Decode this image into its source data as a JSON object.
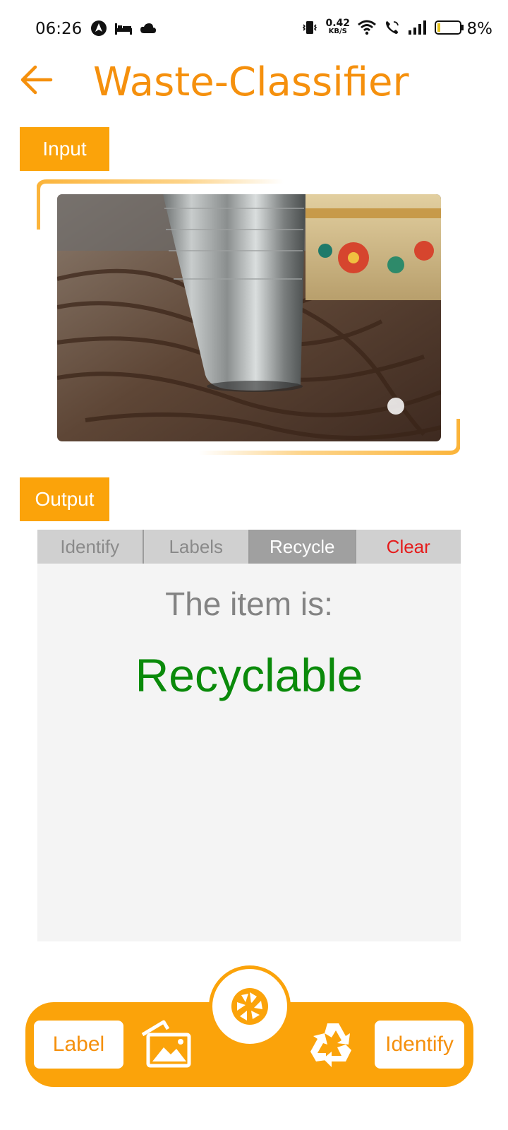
{
  "status_bar": {
    "time": "06:26",
    "net_speed_value": "0.42",
    "net_speed_unit": "KB/S",
    "battery": "8%"
  },
  "app": {
    "title": "Waste-Classifier"
  },
  "input_section": {
    "label": "Input"
  },
  "output_section": {
    "label": "Output",
    "tabs": [
      "Identify",
      "Labels",
      "Recycle",
      "Clear"
    ],
    "active_tab": "Recycle",
    "prompt": "The item is:",
    "result": "Recyclable"
  },
  "bottom_bar": {
    "label_button": "Label",
    "identify_button": "Identify"
  },
  "colors": {
    "accent": "#fba30a",
    "title": "#f5900d",
    "result_green": "#0a8a0a",
    "clear_red": "#e51c1c"
  }
}
